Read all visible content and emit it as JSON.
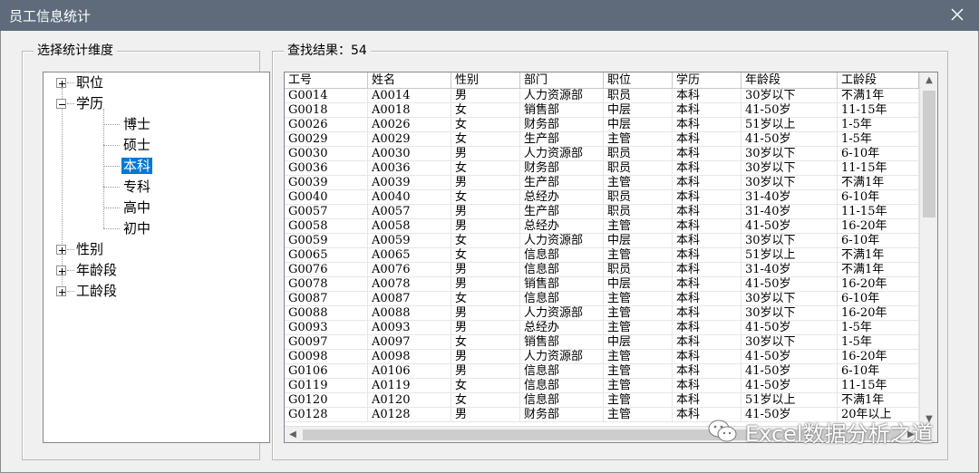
{
  "window": {
    "title": "员工信息统计"
  },
  "dimension_group": {
    "label": "选择统计维度",
    "tree": [
      {
        "label": "职位",
        "expanded": false
      },
      {
        "label": "学历",
        "expanded": true,
        "children": [
          "博士",
          "硕士",
          "本科",
          "专科",
          "高中",
          "初中"
        ],
        "selected": "本科"
      },
      {
        "label": "性别",
        "expanded": false
      },
      {
        "label": "年龄段",
        "expanded": false
      },
      {
        "label": "工龄段",
        "expanded": false
      }
    ]
  },
  "result_group": {
    "label": "查找结果：54",
    "columns": [
      "工号",
      "姓名",
      "性别",
      "部门",
      "职位",
      "学历",
      "年龄段",
      "工龄段"
    ],
    "rows": [
      [
        "G0014",
        "A0014",
        "男",
        "人力资源部",
        "职员",
        "本科",
        "30岁以下",
        "不满1年"
      ],
      [
        "G0018",
        "A0018",
        "女",
        "销售部",
        "中层",
        "本科",
        "41-50岁",
        "11-15年"
      ],
      [
        "G0026",
        "A0026",
        "女",
        "财务部",
        "中层",
        "本科",
        "51岁以上",
        "1-5年"
      ],
      [
        "G0029",
        "A0029",
        "女",
        "生产部",
        "主管",
        "本科",
        "41-50岁",
        "1-5年"
      ],
      [
        "G0030",
        "A0030",
        "男",
        "人力资源部",
        "职员",
        "本科",
        "30岁以下",
        "6-10年"
      ],
      [
        "G0036",
        "A0036",
        "女",
        "财务部",
        "职员",
        "本科",
        "30岁以下",
        "11-15年"
      ],
      [
        "G0039",
        "A0039",
        "男",
        "生产部",
        "主管",
        "本科",
        "30岁以下",
        "不满1年"
      ],
      [
        "G0040",
        "A0040",
        "女",
        "总经办",
        "职员",
        "本科",
        "31-40岁",
        "6-10年"
      ],
      [
        "G0057",
        "A0057",
        "男",
        "生产部",
        "职员",
        "本科",
        "31-40岁",
        "11-15年"
      ],
      [
        "G0058",
        "A0058",
        "男",
        "总经办",
        "主管",
        "本科",
        "41-50岁",
        "16-20年"
      ],
      [
        "G0059",
        "A0059",
        "女",
        "人力资源部",
        "中层",
        "本科",
        "30岁以下",
        "6-10年"
      ],
      [
        "G0065",
        "A0065",
        "女",
        "信息部",
        "主管",
        "本科",
        "51岁以上",
        "不满1年"
      ],
      [
        "G0076",
        "A0076",
        "男",
        "信息部",
        "职员",
        "本科",
        "31-40岁",
        "不满1年"
      ],
      [
        "G0078",
        "A0078",
        "男",
        "销售部",
        "中层",
        "本科",
        "41-50岁",
        "16-20年"
      ],
      [
        "G0087",
        "A0087",
        "女",
        "信息部",
        "主管",
        "本科",
        "30岁以下",
        "6-10年"
      ],
      [
        "G0088",
        "A0088",
        "男",
        "人力资源部",
        "主管",
        "本科",
        "30岁以下",
        "16-20年"
      ],
      [
        "G0093",
        "A0093",
        "男",
        "总经办",
        "主管",
        "本科",
        "41-50岁",
        "1-5年"
      ],
      [
        "G0097",
        "A0097",
        "女",
        "销售部",
        "中层",
        "本科",
        "30岁以下",
        "1-5年"
      ],
      [
        "G0098",
        "A0098",
        "男",
        "人力资源部",
        "主管",
        "本科",
        "41-50岁",
        "16-20年"
      ],
      [
        "G0106",
        "A0106",
        "男",
        "信息部",
        "主管",
        "本科",
        "41-50岁",
        "6-10年"
      ],
      [
        "G0119",
        "A0119",
        "女",
        "信息部",
        "主管",
        "本科",
        "41-50岁",
        "11-15年"
      ],
      [
        "G0120",
        "A0120",
        "女",
        "信息部",
        "主管",
        "本科",
        "51岁以上",
        "不满1年"
      ],
      [
        "G0128",
        "A0128",
        "男",
        "财务部",
        "主管",
        "本科",
        "41-50岁",
        "20年以上"
      ]
    ]
  },
  "watermark": {
    "text": "Excel数据分析之道"
  },
  "icons": {
    "close": "close-icon",
    "expand": "plus-box-icon",
    "collapse": "minus-box-icon",
    "scroll_up": "chevron-up-icon",
    "scroll_down": "chevron-down-icon",
    "scroll_left": "chevron-left-icon",
    "scroll_right": "chevron-right-icon",
    "watermark": "wechat-icon"
  },
  "colors": {
    "titlebar": "#5f6b7a",
    "selection": "#0078d7",
    "window": "#f0f0f0"
  }
}
